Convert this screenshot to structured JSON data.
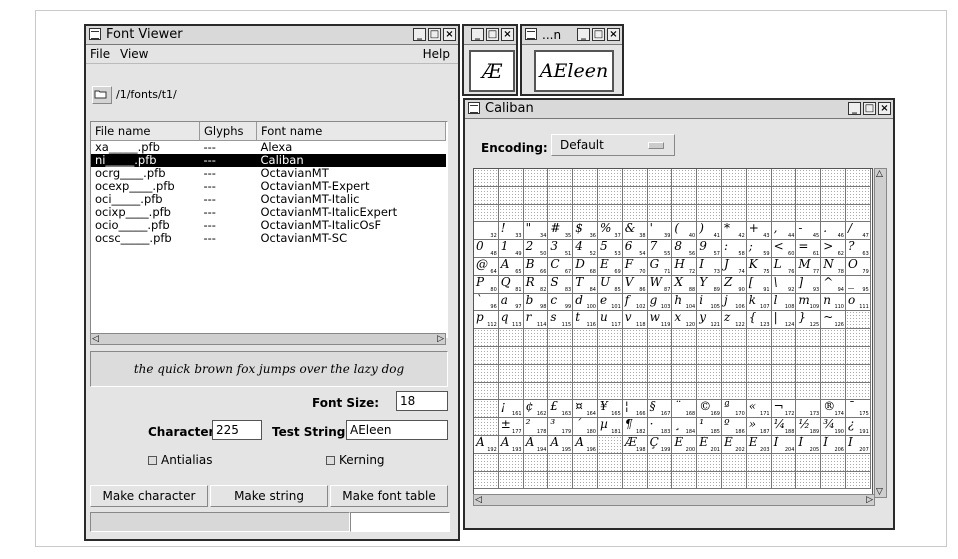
{
  "font_viewer": {
    "title": "Font Viewer",
    "menu": {
      "file": "File",
      "view": "View",
      "help": "Help"
    },
    "path": "/1/fonts/t1/",
    "columns": [
      "File name",
      "Glyphs",
      "Font name"
    ],
    "files": [
      {
        "file": "xa_____.pfb",
        "glyphs": "---",
        "font": "Alexa",
        "selected": false
      },
      {
        "file": "ni_____.pfb",
        "glyphs": "---",
        "font": "Caliban",
        "selected": true
      },
      {
        "file": "ocrg____.pfb",
        "glyphs": "---",
        "font": "OctavianMT",
        "selected": false
      },
      {
        "file": "ocexp____.pfb",
        "glyphs": "---",
        "font": "OctavianMT-Expert",
        "selected": false
      },
      {
        "file": "oci_____.pfb",
        "glyphs": "---",
        "font": "OctavianMT-Italic",
        "selected": false
      },
      {
        "file": "ocixp____.pfb",
        "glyphs": "---",
        "font": "OctavianMT-ItalicExpert",
        "selected": false
      },
      {
        "file": "ocio_____.pfb",
        "glyphs": "---",
        "font": "OctavianMT-ItalicOsF",
        "selected": false
      },
      {
        "file": "ocsc_____.pfb",
        "glyphs": "---",
        "font": "OctavianMT-SC",
        "selected": false
      }
    ],
    "preview_text": "the quick brown fox jumps over the lazy dog",
    "font_size_label": "Font Size:",
    "font_size_value": "18",
    "character_label": "Character:",
    "character_value": "225",
    "test_string_label": "Test String:",
    "test_string_value": "AEleen",
    "antialias_label": "Antialias",
    "kerning_label": "Kerning",
    "buttons": {
      "make_character": "Make character",
      "make_string": "Make string",
      "make_font_table": "Make font table"
    }
  },
  "char_window": {
    "glyph": "Æ"
  },
  "string_window": {
    "title": "...n",
    "text": "AEleen"
  },
  "caliban": {
    "title": "Caliban",
    "encoding_label": "Encoding:",
    "encoding_value": "Default"
  }
}
